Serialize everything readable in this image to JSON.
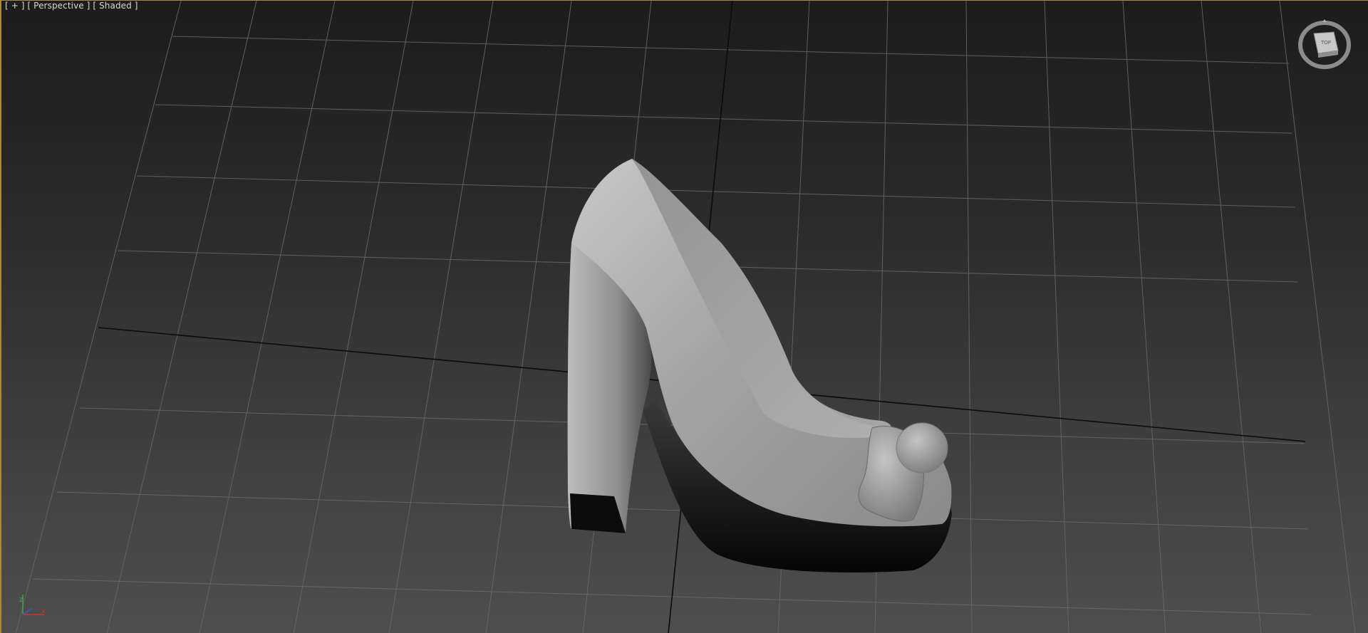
{
  "viewport": {
    "label_plus": "[ + ]",
    "label_view": "[ Perspective ]",
    "label_shading": "[ Shaded ]",
    "active_border_color": "#a88b3a"
  },
  "viewcube": {
    "face_label": "TOP",
    "icon": "viewcube-icon"
  },
  "axis_tripod": {
    "z_label": "z",
    "x_label": "x",
    "z_color": "#3fa34d",
    "x_color": "#c83a2a",
    "y_color": "#2f5fd0"
  },
  "scene": {
    "object": "high-heel-shoe-model",
    "grid_color": "#6a6a6a",
    "axis_line_color": "#0a0a0a",
    "model_color": "#a8a8a8"
  }
}
